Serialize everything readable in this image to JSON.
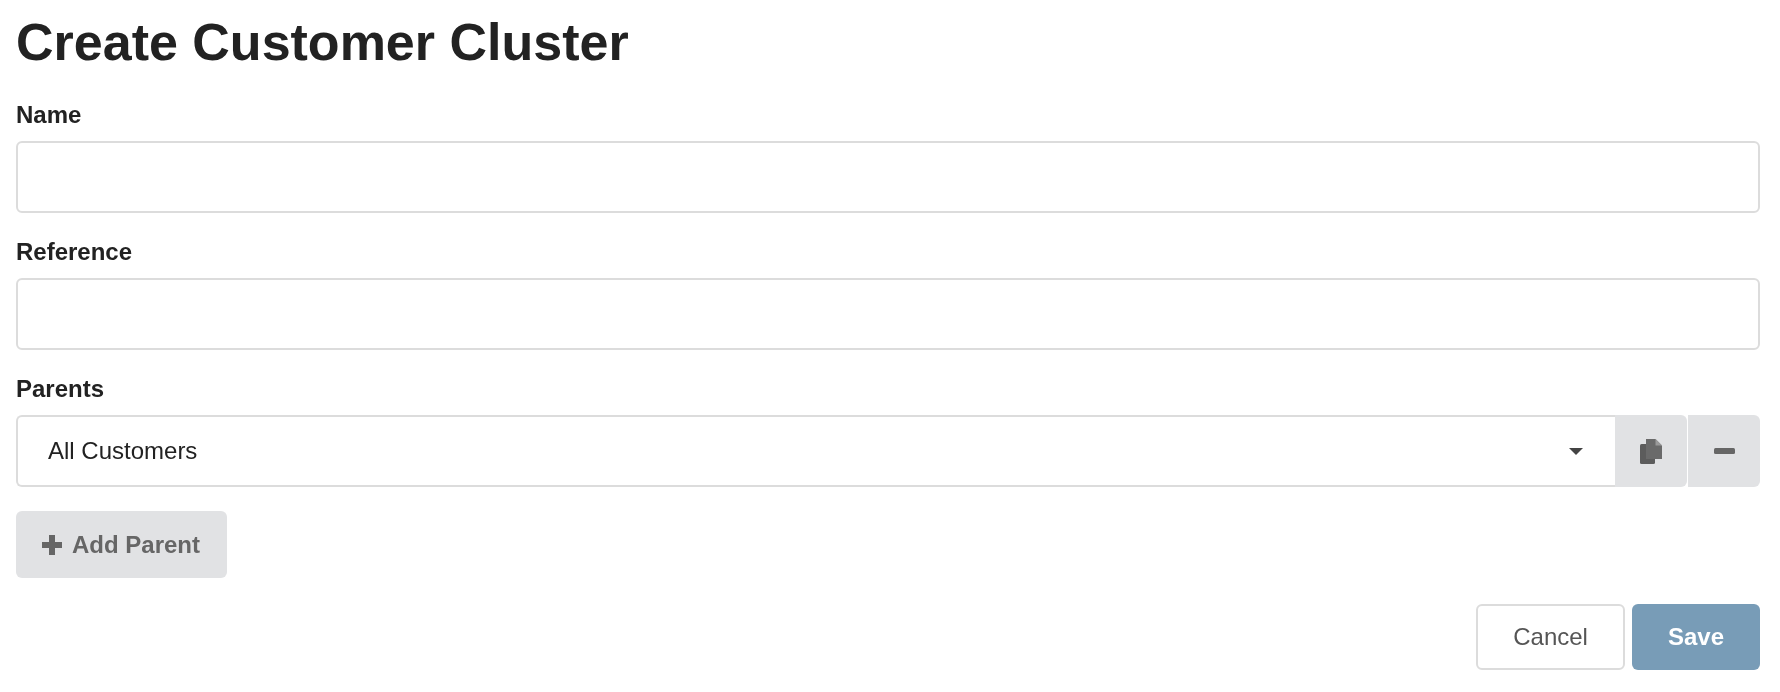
{
  "title": "Create Customer Cluster",
  "fields": [
    {
      "label": "Name"
    },
    {
      "label": "Reference"
    }
  ],
  "parents": {
    "label": "Parents",
    "rows": [
      {
        "value": "All Customers"
      }
    ],
    "add_button": "Add Parent"
  },
  "actions": [
    {
      "kind": "secondary",
      "label": "Cancel"
    },
    {
      "kind": "primary",
      "label": "Save"
    }
  ]
}
